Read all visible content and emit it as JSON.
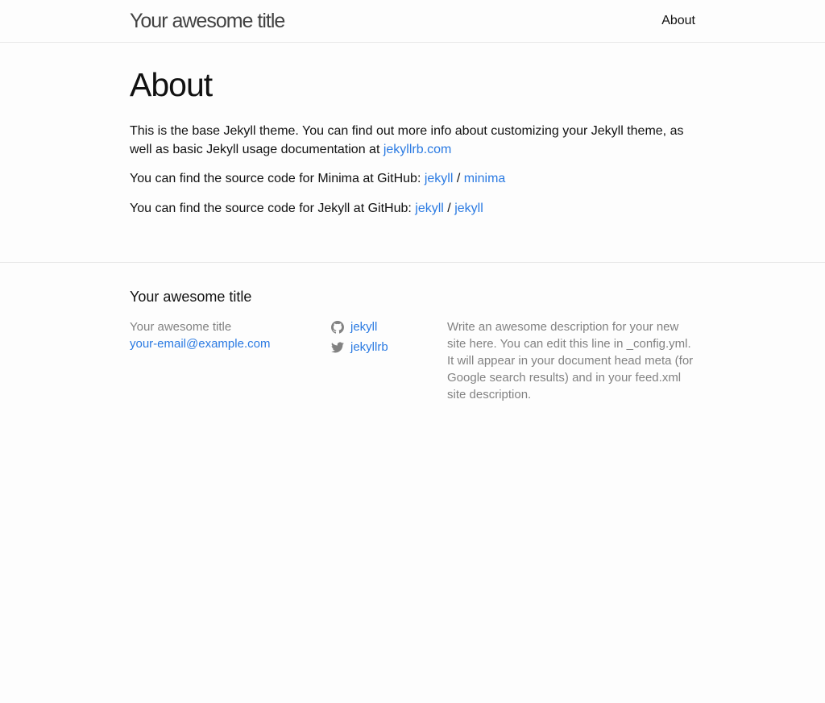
{
  "header": {
    "site_title": "Your awesome title",
    "nav": [
      {
        "label": "About"
      }
    ]
  },
  "main": {
    "title": "About",
    "p1": {
      "text": "This is the base Jekyll theme. You can find out more info about customizing your Jekyll theme, as well as basic Jekyll usage documentation at ",
      "link": "jekyllrb.com"
    },
    "p2": {
      "text": "You can find the source code for Minima at GitHub: ",
      "link1": "jekyll",
      "sep": " / ",
      "link2": "minima"
    },
    "p3": {
      "text": "You can find the source code for Jekyll at GitHub: ",
      "link1": "jekyll",
      "sep": " / ",
      "link2": "jekyll"
    }
  },
  "footer": {
    "heading": "Your awesome title",
    "col1": {
      "name": "Your awesome title",
      "email": "your-email@example.com"
    },
    "social": [
      {
        "icon": "github-icon",
        "label": "jekyll"
      },
      {
        "icon": "twitter-icon",
        "label": "jekyllrb"
      }
    ],
    "description": "Write an awesome description for your new site here. You can edit this line in _config.yml. It will appear in your document head meta (for Google search results) and in your feed.xml site description."
  },
  "colors": {
    "link": "#2a7ae2",
    "text": "#111111",
    "muted": "#828282",
    "border": "#e8e8e8",
    "background": "#fdfdfd"
  }
}
